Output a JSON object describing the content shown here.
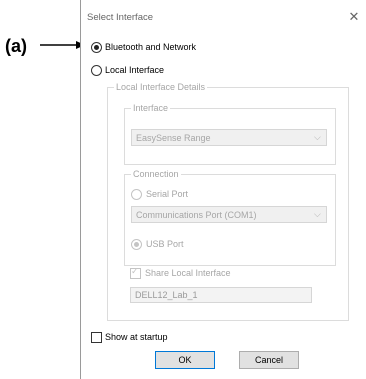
{
  "annotation": {
    "label": "(a)"
  },
  "dialog": {
    "title": "Select Interface",
    "option_bluetooth": "Bluetooth and Network",
    "option_local": "Local Interface",
    "local_details_group": "Local Interface Details",
    "interface_group": "Interface",
    "interface_value": "EasySense Range",
    "connection_group": "Connection",
    "serial_port_label": "Serial Port",
    "comm_port_value": "Communications Port (COM1)",
    "usb_port_label": "USB Port",
    "share_label": "Share Local Interface",
    "share_name_value": "DELL12_Lab_1",
    "show_startup_label": "Show at startup",
    "ok_label": "OK",
    "cancel_label": "Cancel"
  }
}
